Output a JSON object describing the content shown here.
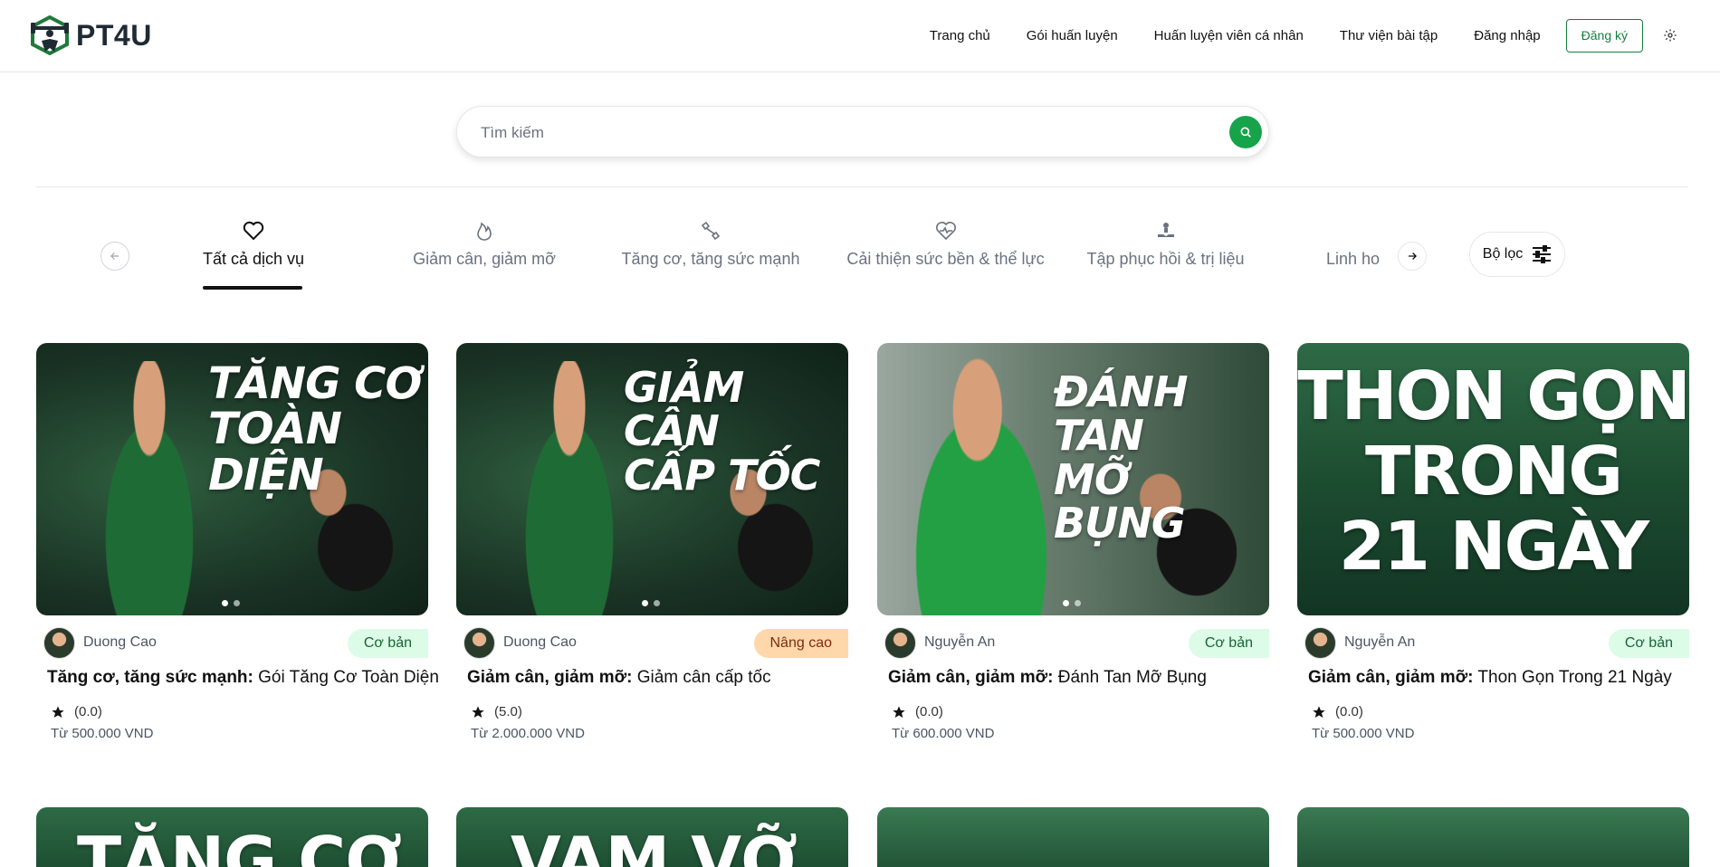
{
  "brand": {
    "name": "PT4U",
    "primary": "#15803d",
    "accent": "#16a34a"
  },
  "nav": {
    "items": [
      "Trang chủ",
      "Gói huấn luyện",
      "Huấn luyện viên cá nhân",
      "Thư viện bài tập",
      "Đăng nhập"
    ],
    "signup": "Đăng ký",
    "settings_icon": "gear-icon"
  },
  "search": {
    "placeholder": "Tìm kiếm",
    "icon": "search-icon"
  },
  "categories": [
    {
      "label": "Tất cả dịch vụ",
      "icon": "heart-icon",
      "active": true
    },
    {
      "label": "Giảm cân, giảm mỡ",
      "icon": "flame-icon",
      "active": false
    },
    {
      "label": "Tăng cơ, tăng sức mạnh",
      "icon": "dumbbell-icon",
      "active": false
    },
    {
      "label": "Cải thiện sức bền & thể lực",
      "icon": "heartbeat-icon",
      "active": false
    },
    {
      "label": "Tập phục hồi & trị liệu",
      "icon": "hand-heart-icon",
      "active": false
    },
    {
      "label": "Linh ho",
      "icon": "",
      "active": false
    }
  ],
  "filter": {
    "label": "Bộ lọc",
    "icon": "sliders-icon"
  },
  "cards": [
    {
      "image_text": [
        "TĂNG CƠ",
        "TOÀN DIỆN"
      ],
      "trainer": "Duong Cao",
      "level": "Cơ bản",
      "level_type": "basic",
      "category": "Tăng cơ, tăng sức mạnh:",
      "name": "Gói Tăng Cơ Toàn Diện",
      "rating": "(0.0)",
      "price": "Từ 500.000 VND"
    },
    {
      "image_text": [
        "GIẢM CÂN",
        "CẤP TỐC"
      ],
      "trainer": "Duong Cao",
      "level": "Nâng cao",
      "level_type": "adv",
      "category": "Giảm cân, giảm mỡ:",
      "name": "Giảm cân cấp tốc",
      "rating": "(5.0)",
      "price": "Từ 2.000.000 VND"
    },
    {
      "image_text": [
        "ĐÁNH TAN",
        "MỠ BỤNG"
      ],
      "trainer": "Nguyễn An",
      "level": "Cơ bản",
      "level_type": "basic",
      "category": "Giảm cân, giảm mỡ:",
      "name": "Đánh Tan Mỡ Bụng",
      "rating": "(0.0)",
      "price": "Từ 600.000 VND"
    },
    {
      "image_text": [
        "THON GỌN",
        "TRONG",
        "21 NGÀY"
      ],
      "trainer": "Nguyễn An",
      "level": "Cơ bản",
      "level_type": "basic",
      "category": "Giảm cân, giảm mỡ:",
      "name": "Thon Gọn Trong 21 Ngày",
      "rating": "(0.0)",
      "price": "Từ 500.000 VND"
    }
  ],
  "second_row": [
    {
      "image_text": "TĂNG CƠ"
    },
    {
      "image_text": "VAM VỠ"
    },
    {
      "image_text": ""
    },
    {
      "image_text": ""
    }
  ]
}
